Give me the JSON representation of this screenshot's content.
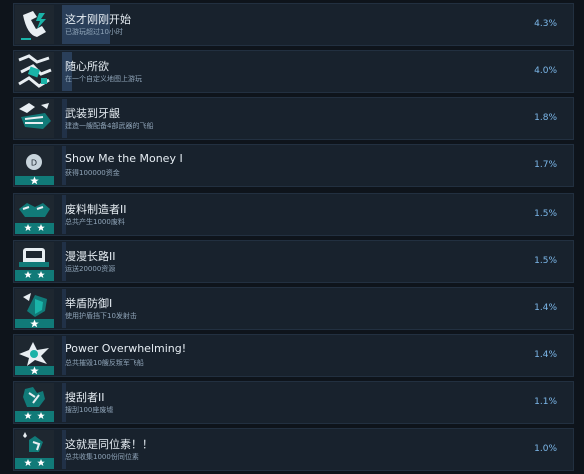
{
  "achievements": [
    {
      "title": "这才刚刚开始",
      "desc": "已游玩超过10小时",
      "pct": "4.3%",
      "icon": "phone-bolt-icon"
    },
    {
      "title": "随心所欲",
      "desc": "在一个自定义地图上游玩",
      "pct": "4.0%",
      "icon": "map-icon"
    },
    {
      "title": "武装到牙龈",
      "desc": "建造一艘配备4部武器的飞船",
      "pct": "1.8%",
      "icon": "armed-ship-icon"
    },
    {
      "title": "Show Me the Money I",
      "desc": "获得100000资金",
      "pct": "1.7%",
      "icon": "coin-icon"
    },
    {
      "title": "废料制造者II",
      "desc": "总共产生1000废料",
      "pct": "1.5%",
      "icon": "scrap-icon"
    },
    {
      "title": "漫漫长路II",
      "desc": "运送20000资源",
      "pct": "1.5%",
      "icon": "truck-icon"
    },
    {
      "title": "举盾防御I",
      "desc": "使用护盾挡下10发射击",
      "pct": "1.4%",
      "icon": "shield-icon"
    },
    {
      "title": "Power Overwhelming!",
      "desc": "总共摧毁10艘反叛军飞船",
      "pct": "1.4%",
      "icon": "explosion-icon"
    },
    {
      "title": "搜刮者II",
      "desc": "搜刮100座废墟",
      "pct": "1.1%",
      "icon": "scavenger-icon"
    },
    {
      "title": "这就是同位素！！",
      "desc": "总共收集1000份同位素",
      "pct": "1.0%",
      "icon": "isotope-icon"
    }
  ],
  "colors": {
    "accent": "#117a78",
    "bar": "#2a3f5a",
    "pct": "#7cb8ea"
  }
}
